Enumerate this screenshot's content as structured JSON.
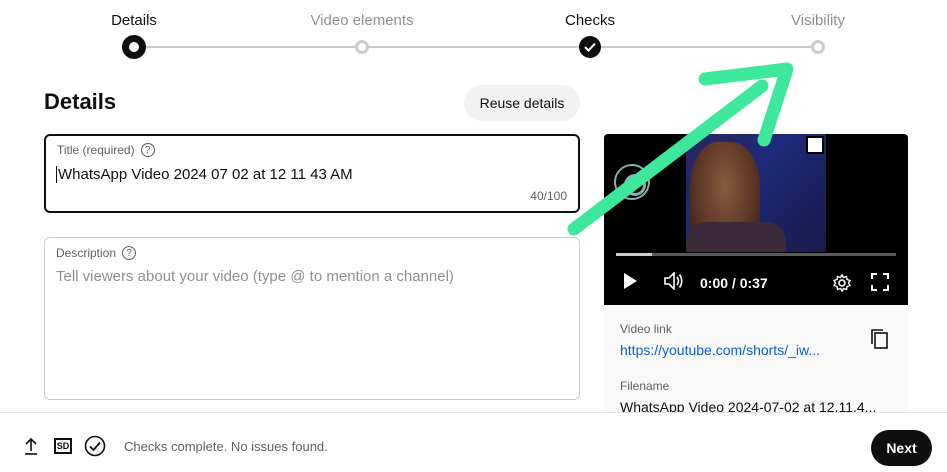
{
  "stepper": {
    "steps": [
      {
        "label": "Details",
        "state": "current"
      },
      {
        "label": "Video elements",
        "state": "upcoming"
      },
      {
        "label": "Checks",
        "state": "done"
      },
      {
        "label": "Visibility",
        "state": "upcoming"
      }
    ]
  },
  "header": {
    "title": "Details",
    "reuse_label": "Reuse details"
  },
  "title_field": {
    "label": "Title (required)",
    "value": "WhatsApp Video 2024 07 02 at 12 11 43 AM",
    "counter": "40/100",
    "help_glyph": "?"
  },
  "description_field": {
    "label": "Description",
    "placeholder": "Tell viewers about your video (type @ to mention a channel)",
    "help_glyph": "?"
  },
  "video": {
    "time": "0:00 / 0:37",
    "progress": 0.13,
    "link_label": "Video link",
    "link_text": "https://youtube.com/shorts/_iw...",
    "filename_label": "Filename",
    "filename": "WhatsApp Video 2024-07-02 at 12.11.4..."
  },
  "footer": {
    "status": "Checks complete. No issues found.",
    "sd_label": "SD",
    "next_label": "Next"
  },
  "colors": {
    "accent_arrow": "#3ee89a",
    "link": "#065fd4",
    "primary": "#0f0f0f"
  },
  "icons": [
    "upload-icon",
    "sd-icon",
    "check-circle-icon",
    "play-icon",
    "volume-icon",
    "settings-icon",
    "fullscreen-icon",
    "copy-icon",
    "help-icon"
  ]
}
